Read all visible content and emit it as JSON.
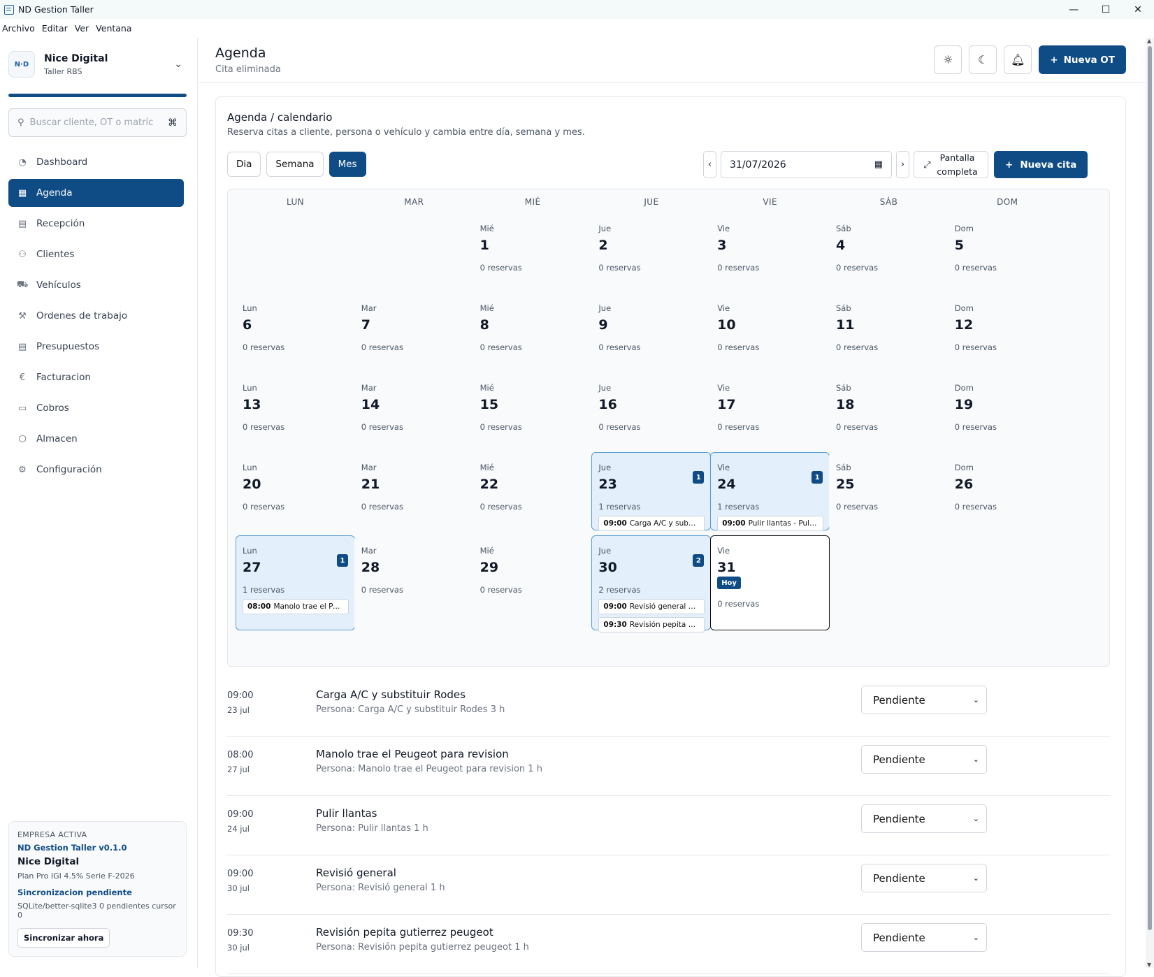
{
  "window": {
    "title": "ND Gestion Taller",
    "controls": [
      "—",
      "☐",
      "✕"
    ]
  },
  "menu": [
    "Archivo",
    "Editar",
    "Ver",
    "Ventana"
  ],
  "sidebar": {
    "logo_text": "N·D",
    "company_name": "Nice Digital",
    "company_sub": "Taller RBS",
    "progress": 1.0,
    "search_placeholder": "Buscar cliente, OT o matríc",
    "search_shortcut": "⌘",
    "nav": [
      {
        "label": "Dashboard",
        "icon": "◔",
        "active": false
      },
      {
        "label": "Agenda",
        "icon": "▦",
        "active": true
      },
      {
        "label": "Recepción",
        "icon": "▤",
        "active": false
      },
      {
        "label": "Clientes",
        "icon": "⚇",
        "active": false
      },
      {
        "label": "Vehículos",
        "icon": "⛟",
        "active": false
      },
      {
        "label": "Ordenes de trabajo",
        "icon": "⚒",
        "active": false
      },
      {
        "label": "Presupuestos",
        "icon": "▤",
        "active": false
      },
      {
        "label": "Facturacion",
        "icon": "€",
        "active": false
      },
      {
        "label": "Cobros",
        "icon": "▭",
        "active": false
      },
      {
        "label": "Almacen",
        "icon": "⬡",
        "active": false
      },
      {
        "label": "Configuración",
        "icon": "⚙",
        "active": false
      }
    ],
    "active_company": {
      "label": "EMPRESA ACTIVA",
      "version": "ND Gestion Taller v0.1.0",
      "name": "Nice Digital",
      "plan": "Plan Pro IGI 4.5% Serie F-2026",
      "sync_status": "Sincronizacion pendiente",
      "db": "SQLite/better-sqlite3 0 pendientes cursor 0",
      "sync_button": "Sincronizar ahora"
    }
  },
  "header": {
    "title": "Agenda",
    "subtitle": "Cita eliminada",
    "new_ot": "Nueva OT",
    "icons": [
      "sun-icon",
      "moon-icon",
      "bell-icon"
    ]
  },
  "agenda": {
    "title": "Agenda / calendario",
    "subtitle": "Reserva citas a cliente, persona o vehículo y cambia entre día, semana y mes.",
    "views": [
      "Dia",
      "Semana",
      "Mes"
    ],
    "active_view": "Mes",
    "date": "31/07/2026",
    "fullscreen_label": "Pantalla completa",
    "new_cita": "Nueva cita",
    "weekdays": [
      "LUN",
      "MAR",
      "MIÉ",
      "JUE",
      "VIE",
      "SÁB",
      "DOM"
    ],
    "weeks": [
      [
        null,
        null,
        {
          "dn": "Mié",
          "d": "1",
          "r": "0 reservas"
        },
        {
          "dn": "Jue",
          "d": "2",
          "r": "0 reservas"
        },
        {
          "dn": "Vie",
          "d": "3",
          "r": "0 reservas"
        },
        {
          "dn": "Sáb",
          "d": "4",
          "r": "0 reservas"
        },
        {
          "dn": "Dom",
          "d": "5",
          "r": "0 reservas"
        }
      ],
      [
        {
          "dn": "Lun",
          "d": "6",
          "r": "0 reservas"
        },
        {
          "dn": "Mar",
          "d": "7",
          "r": "0 reservas"
        },
        {
          "dn": "Mié",
          "d": "8",
          "r": "0 reservas"
        },
        {
          "dn": "Jue",
          "d": "9",
          "r": "0 reservas"
        },
        {
          "dn": "Vie",
          "d": "10",
          "r": "0 reservas"
        },
        {
          "dn": "Sáb",
          "d": "11",
          "r": "0 reservas"
        },
        {
          "dn": "Dom",
          "d": "12",
          "r": "0 reservas"
        }
      ],
      [
        {
          "dn": "Lun",
          "d": "13",
          "r": "0 reservas"
        },
        {
          "dn": "Mar",
          "d": "14",
          "r": "0 reservas"
        },
        {
          "dn": "Mié",
          "d": "15",
          "r": "0 reservas"
        },
        {
          "dn": "Jue",
          "d": "16",
          "r": "0 reservas"
        },
        {
          "dn": "Vie",
          "d": "17",
          "r": "0 reservas"
        },
        {
          "dn": "Sáb",
          "d": "18",
          "r": "0 reservas"
        },
        {
          "dn": "Dom",
          "d": "19",
          "r": "0 reservas"
        }
      ],
      [
        {
          "dn": "Lun",
          "d": "20",
          "r": "0 reservas"
        },
        {
          "dn": "Mar",
          "d": "21",
          "r": "0 reservas"
        },
        {
          "dn": "Mié",
          "d": "22",
          "r": "0 reservas"
        },
        {
          "dn": "Jue",
          "d": "23",
          "r": "1 reservas",
          "badge": "1",
          "events": [
            {
              "time": "09:00",
              "text": "Carga A/C y substitu..."
            }
          ]
        },
        {
          "dn": "Vie",
          "d": "24",
          "r": "1 reservas",
          "badge": "1",
          "events": [
            {
              "time": "09:00",
              "text": "Pulir llantas - Pulir ll..."
            }
          ]
        },
        {
          "dn": "Sáb",
          "d": "25",
          "r": "0 reservas"
        },
        {
          "dn": "Dom",
          "d": "26",
          "r": "0 reservas"
        }
      ],
      [
        {
          "dn": "Lun",
          "d": "27",
          "r": "1 reservas",
          "badge": "1",
          "events": [
            {
              "time": "08:00",
              "text": "Manolo trae el Peug..."
            }
          ]
        },
        {
          "dn": "Mar",
          "d": "28",
          "r": "0 reservas"
        },
        {
          "dn": "Mié",
          "d": "29",
          "r": "0 reservas"
        },
        {
          "dn": "Jue",
          "d": "30",
          "r": "2 reservas",
          "badge": "2",
          "events": [
            {
              "time": "09:00",
              "text": "Revisió general - Re..."
            },
            {
              "time": "09:30",
              "text": "Revisión pepita guti..."
            }
          ]
        },
        {
          "dn": "Vie",
          "d": "31",
          "r": "0 reservas",
          "today": true,
          "today_label": "Hoy"
        },
        null,
        null
      ]
    ],
    "appointments": [
      {
        "time": "09:00",
        "date": "23 jul",
        "title": "Carga A/C y substituir Rodes",
        "desc": "Persona: Carga A/C y substituir Rodes 3 h",
        "status": "Pendiente"
      },
      {
        "time": "08:00",
        "date": "27 jul",
        "title": "Manolo trae el Peugeot para revision",
        "desc": "Persona: Manolo trae el Peugeot para revision 1 h",
        "status": "Pendiente"
      },
      {
        "time": "09:00",
        "date": "24 jul",
        "title": "Pulir llantas",
        "desc": "Persona: Pulir llantas 1 h",
        "status": "Pendiente"
      },
      {
        "time": "09:00",
        "date": "30 jul",
        "title": "Revisió general",
        "desc": "Persona: Revisió general 1 h",
        "status": "Pendiente"
      },
      {
        "time": "09:30",
        "date": "30 jul",
        "title": "Revisión pepita gutierrez peugeot",
        "desc": "Persona: Revisión pepita gutierrez peugeot 1 h",
        "status": "Pendiente"
      }
    ]
  }
}
